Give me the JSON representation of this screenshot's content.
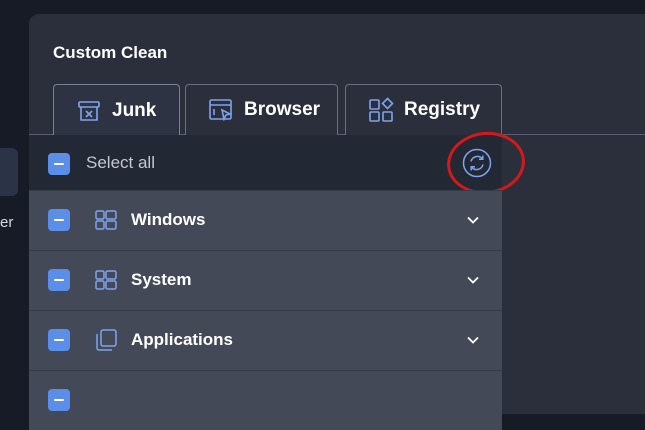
{
  "background": {
    "partial_label": "er"
  },
  "panel": {
    "title": "Custom Clean"
  },
  "tabs": [
    {
      "label": "Junk",
      "icon": "trash-box-icon",
      "active": true
    },
    {
      "label": "Browser",
      "icon": "browser-window-icon",
      "active": false
    },
    {
      "label": "Registry",
      "icon": "registry-grid-icon",
      "active": false
    }
  ],
  "select_all": {
    "label": "Select all",
    "state": "indeterminate"
  },
  "categories": [
    {
      "label": "Windows",
      "icon": "windows-grid-icon",
      "state": "indeterminate"
    },
    {
      "label": "System",
      "icon": "windows-grid-icon",
      "state": "indeterminate"
    },
    {
      "label": "Applications",
      "icon": "app-stack-icon",
      "state": "indeterminate"
    }
  ],
  "colors": {
    "accent": "#5b8ee8",
    "annotation": "#d3191b",
    "panel_bg": "#2b2f3b",
    "row_bg": "#444957"
  }
}
